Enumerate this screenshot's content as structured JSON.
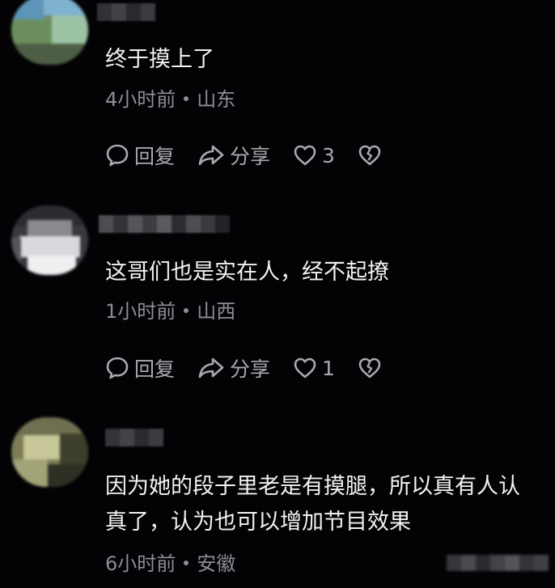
{
  "comments": [
    {
      "text_lines": [
        "终于摸上了"
      ],
      "time": "4小时前",
      "location": "山东",
      "reply_label": "回复",
      "share_label": "分享",
      "like_count": "3"
    },
    {
      "text_lines": [
        "这哥们也是实在人，经不起撩"
      ],
      "time": "1小时前",
      "location": "山西",
      "reply_label": "回复",
      "share_label": "分享",
      "like_count": "1"
    },
    {
      "text_lines": [
        "因为她的段子里老是有摸腿，所以真有人认",
        "真了，认为也可以增加节目效果"
      ],
      "time": "6小时前",
      "location": "安徽"
    }
  ],
  "icons": {
    "reply": "speech-bubble-icon",
    "share": "share-arrow-icon",
    "like": "heart-icon",
    "dislike": "broken-heart-icon"
  },
  "colors": {
    "background": "#030306",
    "text_primary": "#f2f2f2",
    "text_secondary": "#8d8d93",
    "icon": "#a9a9ad"
  }
}
